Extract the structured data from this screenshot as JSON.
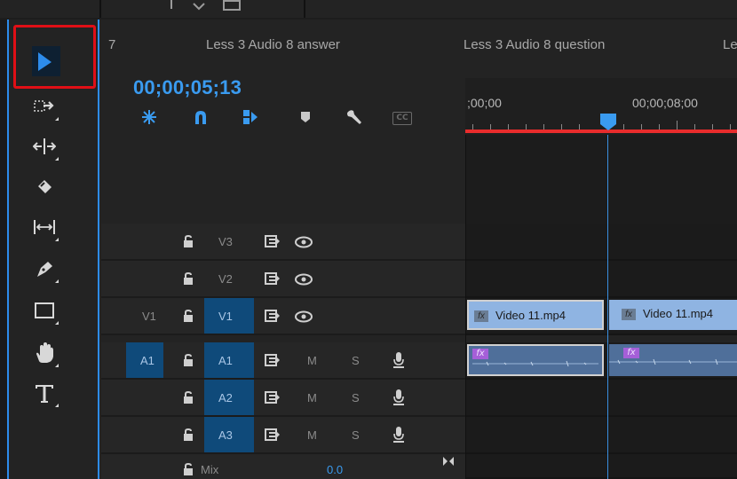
{
  "tools": [
    {
      "name": "selection-tool",
      "icon": "arrow-select-icon"
    },
    {
      "name": "track-select-tool",
      "icon": "track-select-forward-icon"
    },
    {
      "name": "ripple-edit-tool",
      "icon": "ripple-edit-icon"
    },
    {
      "name": "razor-tool",
      "icon": "razor-icon"
    },
    {
      "name": "slip-tool",
      "icon": "slip-icon"
    },
    {
      "name": "pen-tool",
      "icon": "pen-icon"
    },
    {
      "name": "rectangle-tool",
      "icon": "rectangle-icon"
    },
    {
      "name": "hand-tool",
      "icon": "hand-icon"
    },
    {
      "name": "type-tool",
      "icon": "type-icon"
    }
  ],
  "tabs": {
    "partial_left": "7",
    "tab1": "Less 3 Audio 8 answer",
    "tab2": "Less 3 Audio 8 question",
    "partial_right": "Le"
  },
  "timecode": "00;00;05;13",
  "ruler": {
    "t0": ";00;00",
    "t1": "00;00;08;00"
  },
  "tracks": {
    "v3": {
      "target": "V3"
    },
    "v2": {
      "target": "V2"
    },
    "v1": {
      "source": "V1",
      "target": "V1"
    },
    "a1": {
      "source": "A1",
      "target": "A1",
      "mute": "M",
      "solo": "S"
    },
    "a2": {
      "target": "A2",
      "mute": "M",
      "solo": "S"
    },
    "a3": {
      "target": "A3",
      "mute": "M",
      "solo": "S"
    },
    "mix": {
      "label": "Mix",
      "value": "0.0"
    }
  },
  "clips": {
    "fx": "fx",
    "video1": "Video 11.mp4",
    "video2": "Video 11.mp4"
  },
  "colors": {
    "accent": "#2d8ceb",
    "timecode": "#3a9bf0",
    "highlight_frame": "#e00f16",
    "video_clip": "#8fb4e2",
    "audio_clip": "#4f6f9a",
    "fx_badge": "#a55fd8"
  }
}
